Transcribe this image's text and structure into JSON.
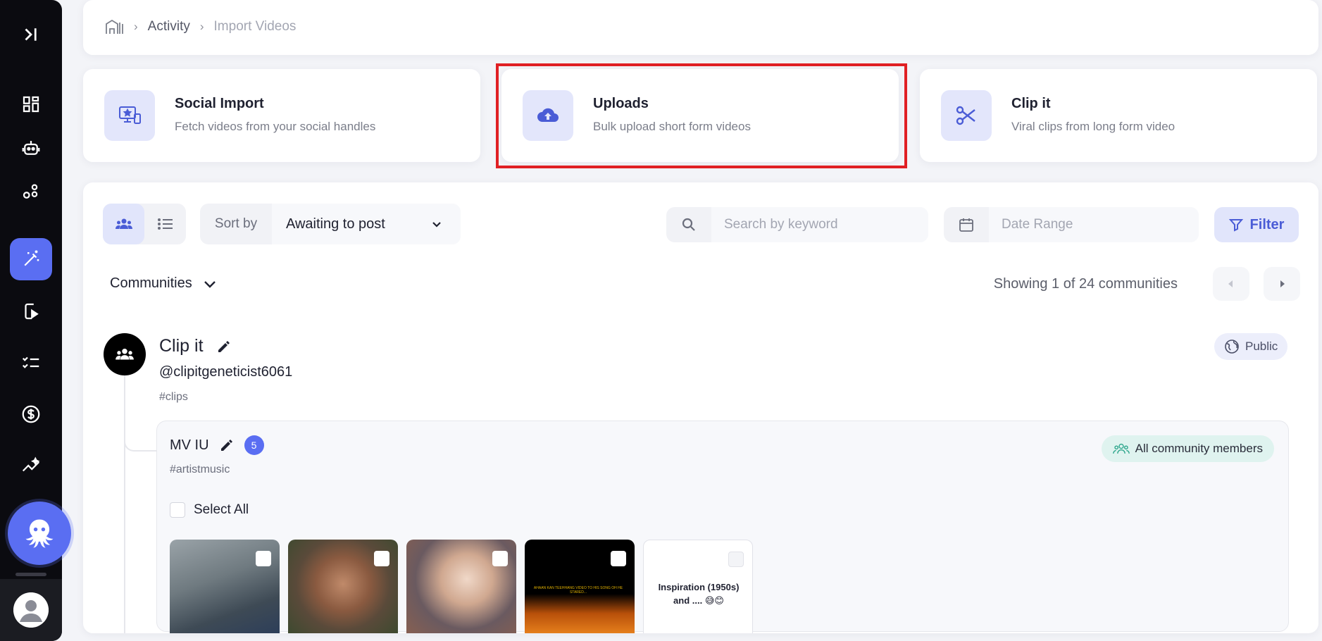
{
  "breadcrumb": {
    "items": [
      "Activity",
      "Import Videos"
    ]
  },
  "import_options": [
    {
      "title": "Social Import",
      "description": "Fetch videos from your social handles",
      "icon": "social-import-icon"
    },
    {
      "title": "Uploads",
      "description": "Bulk upload short form videos",
      "icon": "cloud-upload-icon"
    },
    {
      "title": "Clip it",
      "description": "Viral clips from long form video",
      "icon": "scissors-icon"
    }
  ],
  "toolbar": {
    "sort_label": "Sort by",
    "sort_value": "Awaiting to post",
    "search_placeholder": "Search by keyword",
    "date_placeholder": "Date Range",
    "filter_label": "Filter"
  },
  "communities_label": "Communities",
  "showing_text": "Showing 1 of 24 communities",
  "community": {
    "name": "Clip it",
    "handle": "@clipitgeneticist6061",
    "tag": "#clips",
    "visibility": "Public",
    "sub": {
      "name": "MV IU",
      "count": "5",
      "tag": "#artistmusic",
      "audience": "All community members",
      "select_all_label": "Select All",
      "thumbnails": [
        {
          "caption": ""
        },
        {
          "caption": ""
        },
        {
          "caption": ""
        },
        {
          "caption": "AHAAN KAN TEEHHANG VIDEO TO HIS SONG OH HE STARED..."
        },
        {
          "caption": "Inspiration (1950s) and .... 😅😊"
        }
      ]
    }
  },
  "colors": {
    "accent": "#5a6ef2",
    "highlight_border": "#e02024",
    "sidebar_bg": "#0b0b10"
  }
}
